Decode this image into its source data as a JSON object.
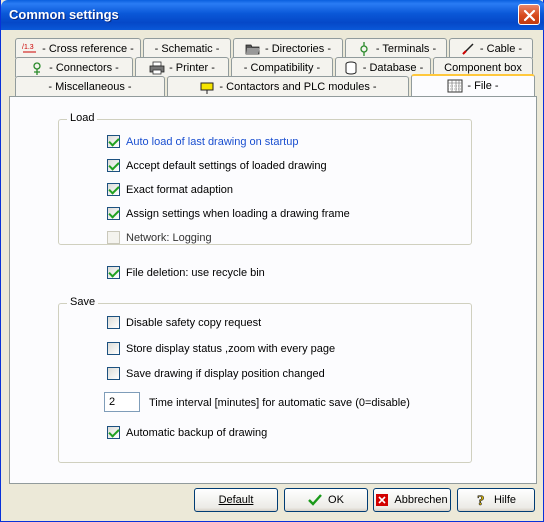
{
  "window": {
    "title": "Common settings"
  },
  "tabs": {
    "row1": [
      {
        "label": "- Cross reference -",
        "icon": "cross-reference-icon"
      },
      {
        "label": "- Schematic -",
        "icon": ""
      },
      {
        "label": "- Directories -",
        "icon": "folder-icon"
      },
      {
        "label": "- Terminals -",
        "icon": "terminal-icon"
      },
      {
        "label": "- Cable -",
        "icon": "cable-icon"
      }
    ],
    "row2": [
      {
        "label": "- Connectors -",
        "icon": "connector-icon"
      },
      {
        "label": "- Printer -",
        "icon": "printer-icon"
      },
      {
        "label": "- Compatibility -",
        "icon": ""
      },
      {
        "label": "- Database -",
        "icon": "database-icon"
      },
      {
        "label": "Component box",
        "icon": ""
      }
    ],
    "row3": [
      {
        "label": "- Miscellaneous -",
        "icon": ""
      },
      {
        "label": "- Contactors and PLC modules -",
        "icon": "contactor-icon"
      },
      {
        "label": "- File -",
        "icon": "file-grid-icon",
        "active": true
      }
    ]
  },
  "load_group": {
    "label": "Load",
    "options": [
      {
        "label": "Auto load of last drawing on startup",
        "checked": true
      },
      {
        "label": "Accept default settings of loaded drawing",
        "checked": true
      },
      {
        "label": "Exact format adaption",
        "checked": true
      },
      {
        "label": "Assign settings when loading a drawing frame",
        "checked": true
      },
      {
        "label": "Network: Logging",
        "checked": false
      }
    ]
  },
  "file_deletion": {
    "label": "File deletion: use recycle bin",
    "checked": true
  },
  "save_group": {
    "label": "Save",
    "options": [
      {
        "label": "Disable safety copy request",
        "checked": false
      },
      {
        "label": "Store display status ,zoom with every page",
        "checked": false
      },
      {
        "label": "Save drawing if display position changed",
        "checked": false
      }
    ],
    "interval_value": "2",
    "interval_label": "Time interval [minutes] for automatic save (0=disable)",
    "backup": {
      "label": "Automatic backup of drawing",
      "checked": true
    }
  },
  "buttons": {
    "default": "Default",
    "ok": "OK",
    "cancel": "Abbrechen",
    "help": "Hilfe"
  }
}
